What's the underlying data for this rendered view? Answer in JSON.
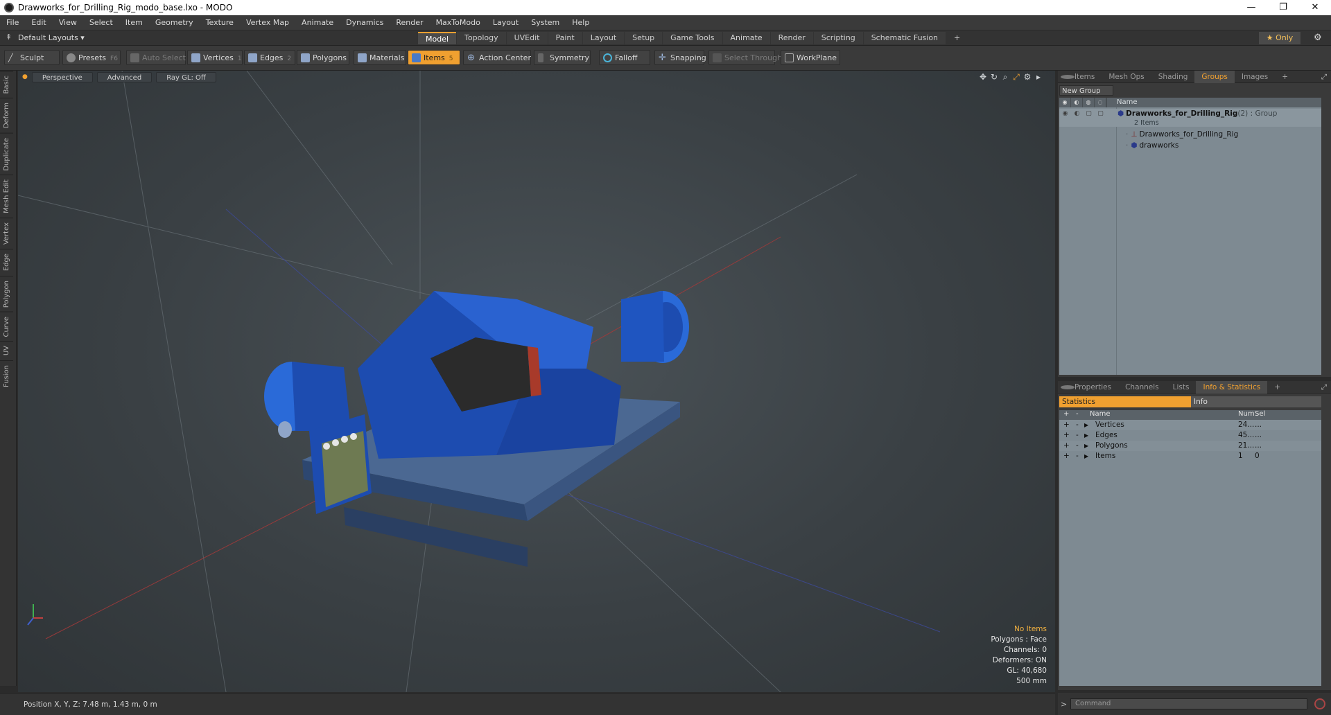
{
  "window": {
    "title": "Drawworks_for_Drilling_Rig_modo_base.lxo - MODO",
    "controls": [
      "—",
      "❐",
      "✕"
    ]
  },
  "menu": [
    "File",
    "Edit",
    "View",
    "Select",
    "Item",
    "Geometry",
    "Texture",
    "Vertex Map",
    "Animate",
    "Dynamics",
    "Render",
    "MaxToModo",
    "Layout",
    "System",
    "Help"
  ],
  "layout": {
    "dropdown": "Default Layouts ▾",
    "tabs": [
      "Model",
      "Topology",
      "UVEdit",
      "Paint",
      "Layout",
      "Setup",
      "Game Tools",
      "Animate",
      "Render",
      "Scripting",
      "Schematic Fusion",
      "+"
    ],
    "active_tab": "Model",
    "only": "★  Only"
  },
  "toolbar": {
    "sculpt": "Sculpt",
    "presets": "Presets",
    "presets_key": "F6",
    "auto_select": "Auto Select",
    "vertices": "Vertices",
    "vertices_key": "1",
    "edges": "Edges",
    "edges_key": "2",
    "polygons": "Polygons",
    "materials": "Materials",
    "items": "Items",
    "items_key": "5",
    "action_center": "Action Center",
    "symmetry": "Symmetry",
    "falloff": "Falloff",
    "snapping": "Snapping",
    "select_through": "Select Through",
    "workplane": "WorkPlane"
  },
  "left_tabs": [
    "Basic",
    "Deform",
    "Duplicate",
    "Mesh Edit",
    "Vertex",
    "Edge",
    "Polygon",
    "Curve",
    "UV",
    "Fusion"
  ],
  "viewport": {
    "view": "Perspective",
    "shading": "Advanced",
    "raygl": "Ray GL: Off",
    "info": {
      "items": "No Items",
      "polygons": "Polygons : Face",
      "channels": "Channels: 0",
      "deformers": "Deformers: ON",
      "gl": "GL: 40,680",
      "scale": "500 mm"
    },
    "colors": {
      "machine": "#1f4fb0",
      "machine_light": "#2e6ad6",
      "skid": "#3d5a86",
      "grid": "#6d767c"
    }
  },
  "status": {
    "position": "Position X, Y, Z:   7.48 m, 1.43 m, 0 m"
  },
  "groups_panel": {
    "tabs": [
      "Items",
      "Mesh Ops",
      "Shading",
      "Groups",
      "Images",
      "+"
    ],
    "active_tab": "Groups",
    "new_group": "New Group",
    "name_header": "Name",
    "group": {
      "name": "Drawworks_for_Drilling_Rig",
      "suffix": " (2) : Group",
      "count": "2 Items",
      "children": [
        "Drawworks_for_Drilling_Rig",
        "drawworks"
      ]
    }
  },
  "stats_panel": {
    "tabs": [
      "Properties",
      "Channels",
      "Lists",
      "Info & Statistics",
      "+"
    ],
    "active_tab": "Info & Statistics",
    "sub_tabs": [
      "Statistics",
      "Info"
    ],
    "headers": {
      "name": "Name",
      "num": "Num",
      "sel": "Sel"
    },
    "rows": [
      {
        "name": "Vertices",
        "num": "24...",
        "sel": "..."
      },
      {
        "name": "Edges",
        "num": "45...",
        "sel": "..."
      },
      {
        "name": "Polygons",
        "num": "21...",
        "sel": "..."
      },
      {
        "name": "Items",
        "num": "1",
        "sel": "0"
      }
    ]
  },
  "command": {
    "placeholder": "Command"
  }
}
